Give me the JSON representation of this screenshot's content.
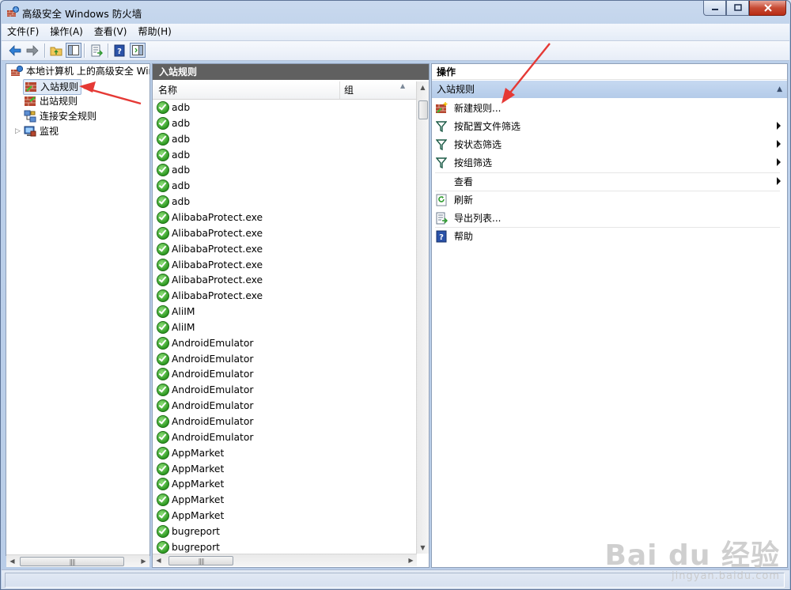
{
  "window": {
    "title": "高级安全 Windows 防火墙"
  },
  "menu": [
    "文件(F)",
    "操作(A)",
    "查看(V)",
    "帮助(H)"
  ],
  "tree": {
    "root": "本地计算机 上的高级安全 Windows 防火墙",
    "items": [
      "入站规则",
      "出站规则",
      "连接安全规则",
      "监视"
    ],
    "selected": "入站规则"
  },
  "list": {
    "pane_title": "入站规则",
    "columns": [
      "名称",
      "组"
    ],
    "rows": [
      "adb",
      "adb",
      "adb",
      "adb",
      "adb",
      "adb",
      "adb",
      "AlibabaProtect.exe",
      "AlibabaProtect.exe",
      "AlibabaProtect.exe",
      "AlibabaProtect.exe",
      "AlibabaProtect.exe",
      "AlibabaProtect.exe",
      "AliIM",
      "AliIM",
      "AndroidEmulator",
      "AndroidEmulator",
      "AndroidEmulator",
      "AndroidEmulator",
      "AndroidEmulator",
      "AndroidEmulator",
      "AndroidEmulator",
      "AppMarket",
      "AppMarket",
      "AppMarket",
      "AppMarket",
      "AppMarket",
      "bugreport",
      "bugreport"
    ]
  },
  "actions": {
    "pane_title": "操作",
    "section": "入站规则",
    "items": [
      {
        "label": "新建规则...",
        "icon": "new-rule-icon",
        "submenu": false
      },
      {
        "label": "按配置文件筛选",
        "icon": "filter-icon",
        "submenu": true
      },
      {
        "label": "按状态筛选",
        "icon": "filter-icon",
        "submenu": true
      },
      {
        "label": "按组筛选",
        "icon": "filter-icon",
        "submenu": true
      },
      {
        "label": "查看",
        "icon": "",
        "submenu": true
      },
      {
        "label": "刷新",
        "icon": "refresh-icon",
        "submenu": false
      },
      {
        "label": "导出列表...",
        "icon": "export-icon",
        "submenu": false
      },
      {
        "label": "帮助",
        "icon": "help-icon",
        "submenu": false
      }
    ]
  },
  "watermark": {
    "main": "Bai du 经验",
    "sub": "jingyan.baidu.com"
  },
  "colors": {
    "accent": "#3b74c3",
    "annotation_arrow": "#e53935",
    "check_green": "#2e9a22"
  }
}
